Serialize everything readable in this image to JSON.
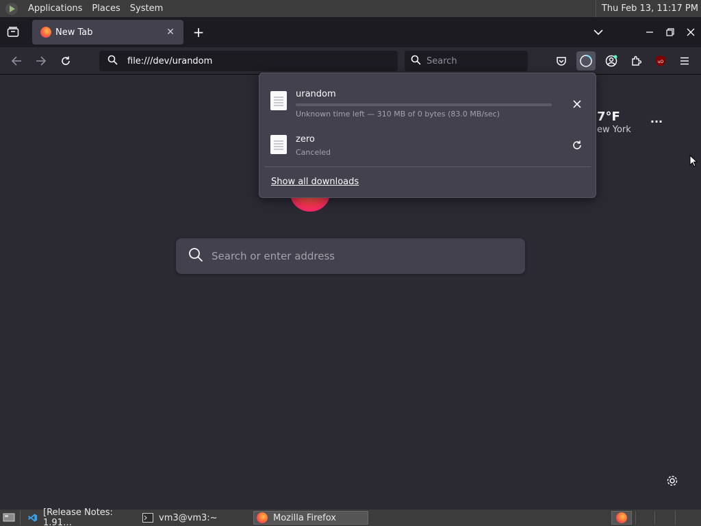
{
  "system_panel": {
    "menus": [
      "Applications",
      "Places",
      "System"
    ],
    "clock": "Thu Feb 13, 11:17 PM"
  },
  "browser": {
    "tab": {
      "title": "New Tab"
    },
    "url": "file:///dev/urandom",
    "search_placeholder": "Search"
  },
  "newtab": {
    "weather_temp": "7°F",
    "weather_city": "ew York",
    "search_placeholder": "Search or enter address"
  },
  "downloads": {
    "items": [
      {
        "name": "urandom",
        "status": "Unknown time left — 310 MB of 0 bytes (83.0 MB/sec)",
        "progress": 0
      },
      {
        "name": "zero",
        "status": "Canceled"
      }
    ],
    "show_all": "Show all downloads"
  },
  "taskbar": {
    "tasks": [
      "[Release Notes: 1.91…",
      "vm3@vm3:~",
      "Mozilla Firefox"
    ]
  },
  "colors": {
    "accent": "#ff7139",
    "page_bg": "#2b2a33",
    "panel_bg": "#42414d"
  }
}
